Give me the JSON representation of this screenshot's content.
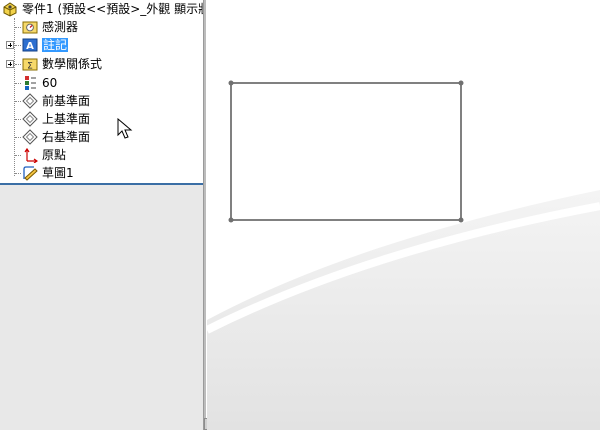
{
  "feature_tree": {
    "root": {
      "label": "零件1 (預設<<預設>_外觀 顯示狀",
      "icon": "part-icon"
    },
    "items": [
      {
        "label": "感測器",
        "icon": "sensor-folder-icon",
        "expandable": false,
        "selected": false
      },
      {
        "label": "註記",
        "icon": "annotation-icon",
        "expandable": true,
        "selected": true
      },
      {
        "label": "數學關係式",
        "icon": "equation-folder-icon",
        "expandable": true,
        "selected": false
      },
      {
        "label": "60",
        "icon": "material-icon",
        "expandable": false,
        "selected": false
      },
      {
        "label": "前基準面",
        "icon": "plane-icon",
        "expandable": false,
        "selected": false
      },
      {
        "label": "上基準面",
        "icon": "plane-icon",
        "expandable": false,
        "selected": false
      },
      {
        "label": "右基準面",
        "icon": "plane-icon",
        "expandable": false,
        "selected": false
      },
      {
        "label": "原點",
        "icon": "origin-icon",
        "expandable": false,
        "selected": false
      },
      {
        "label": "草圖1",
        "icon": "sketch-icon",
        "expandable": false,
        "selected": false
      }
    ]
  },
  "graphics": {
    "sketch_shape": "rectangle",
    "line_color": "#808080"
  }
}
